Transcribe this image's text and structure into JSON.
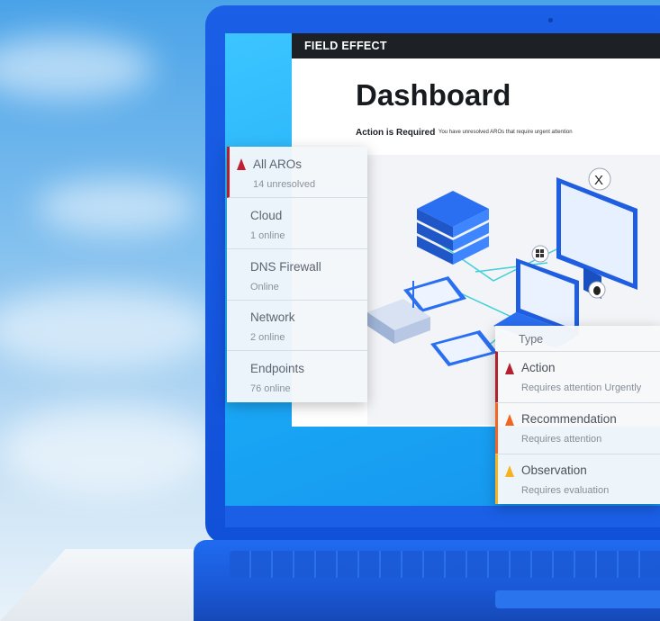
{
  "app": {
    "brand": "FIELD EFFECT",
    "title": "Dashboard",
    "alert_title": "Action is Required",
    "alert_message": "You have unresolved AROs that require urgent attention"
  },
  "aro_panel": {
    "items": [
      {
        "label": "All AROs",
        "sub": "14 unresolved",
        "icon": "warning-icon",
        "color": "#c0202f"
      },
      {
        "label": "Cloud",
        "sub": "1 online"
      },
      {
        "label": "DNS Firewall",
        "sub": "Online"
      },
      {
        "label": "Network",
        "sub": "2 online"
      },
      {
        "label": "Endpoints",
        "sub": "76 online"
      }
    ]
  },
  "type_panel": {
    "header": "Type",
    "items": [
      {
        "label": "Action",
        "sub": "Requires attention Urgently",
        "color": "#b3212f",
        "icon": "warning-icon"
      },
      {
        "label": "Recommendation",
        "sub": "Requires attention",
        "color": "#f26522",
        "icon": "warning-icon"
      },
      {
        "label": "Observation",
        "sub": "Requires evaluation",
        "color": "#f5b324",
        "icon": "warning-icon"
      }
    ]
  },
  "illustration_icons": [
    "server-stack-icon",
    "desktop-monitor-icon",
    "laptop-icon",
    "router-icon",
    "windows-logo-icon",
    "linux-logo-icon",
    "macos-x-logo-icon"
  ]
}
